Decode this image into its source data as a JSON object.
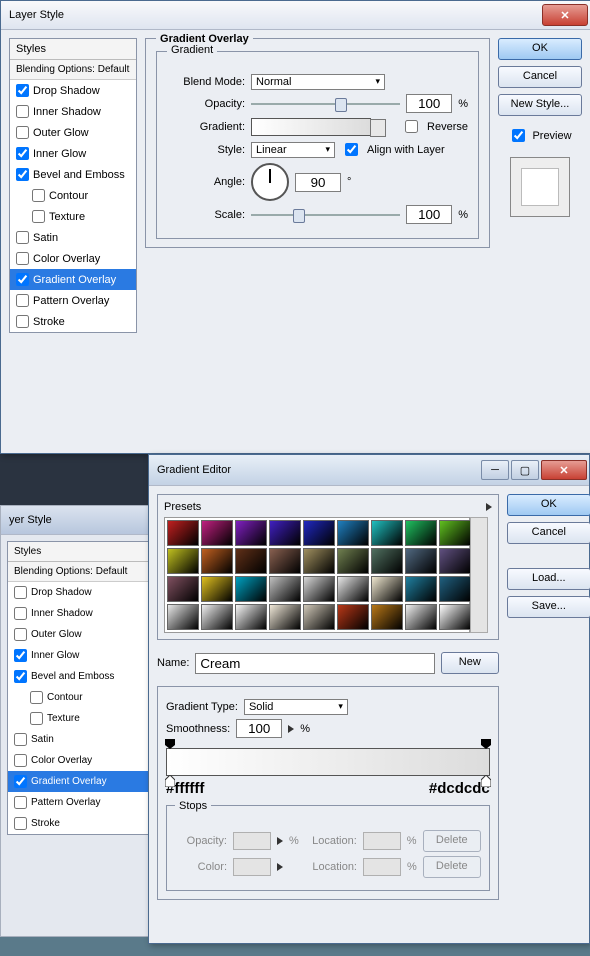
{
  "layerStyle1": {
    "title": "Layer Style",
    "stylesHeader": "Styles",
    "blendingOptions": "Blending Options: Default",
    "items": [
      {
        "label": "Drop Shadow",
        "checked": true,
        "indent": false
      },
      {
        "label": "Inner Shadow",
        "checked": false,
        "indent": false
      },
      {
        "label": "Outer Glow",
        "checked": false,
        "indent": false
      },
      {
        "label": "Inner Glow",
        "checked": true,
        "indent": false
      },
      {
        "label": "Bevel and Emboss",
        "checked": true,
        "indent": false
      },
      {
        "label": "Contour",
        "checked": false,
        "indent": true
      },
      {
        "label": "Texture",
        "checked": false,
        "indent": true
      },
      {
        "label": "Satin",
        "checked": false,
        "indent": false
      },
      {
        "label": "Color Overlay",
        "checked": false,
        "indent": false
      },
      {
        "label": "Gradient Overlay",
        "checked": true,
        "indent": false,
        "selected": true
      },
      {
        "label": "Pattern Overlay",
        "checked": false,
        "indent": false
      },
      {
        "label": "Stroke",
        "checked": false,
        "indent": false
      }
    ],
    "gradientOverlay": {
      "heading": "Gradient Overlay",
      "subheading": "Gradient",
      "blendModeLabel": "Blend Mode:",
      "blendMode": "Normal",
      "opacityLabel": "Opacity:",
      "opacity": "100",
      "opacityUnit": "%",
      "gradientLabel": "Gradient:",
      "reverseLabel": "Reverse",
      "styleLabel": "Style:",
      "style": "Linear",
      "alignLabel": "Align with Layer",
      "angleLabel": "Angle:",
      "angle": "90",
      "angleUnit": "°",
      "scaleLabel": "Scale:",
      "scale": "100",
      "scaleUnit": "%"
    },
    "buttons": {
      "ok": "OK",
      "cancel": "Cancel",
      "newStyle": "New Style...",
      "preview": "Preview"
    }
  },
  "layerStyle2": {
    "title": "yer Style",
    "stylesHeader": "Styles",
    "blendingOptions": "Blending Options: Default",
    "items": [
      {
        "label": "Drop Shadow",
        "checked": false
      },
      {
        "label": "Inner Shadow",
        "checked": false
      },
      {
        "label": "Outer Glow",
        "checked": false
      },
      {
        "label": "Inner Glow",
        "checked": true
      },
      {
        "label": "Bevel and Emboss",
        "checked": true
      },
      {
        "label": "Contour",
        "checked": false,
        "indent": true
      },
      {
        "label": "Texture",
        "checked": false,
        "indent": true
      },
      {
        "label": "Satin",
        "checked": false
      },
      {
        "label": "Color Overlay",
        "checked": false
      },
      {
        "label": "Gradient Overlay",
        "checked": true,
        "selected": true
      },
      {
        "label": "Pattern Overlay",
        "checked": false
      },
      {
        "label": "Stroke",
        "checked": false
      }
    ]
  },
  "gradientEditor": {
    "title": "Gradient Editor",
    "presetsLabel": "Presets",
    "presetColors": [
      "#c02020",
      "#c02080",
      "#8020c0",
      "#4020c0",
      "#2028c0",
      "#2080c0",
      "#20c0c0",
      "#20c060",
      "#60c020",
      "#c0c020",
      "#c06020",
      "#603018",
      "#886050",
      "#a09060",
      "#708050",
      "#507060",
      "#506880",
      "#605080",
      "#805060",
      "#e0c020",
      "#00a0c0",
      "#c0c0c0",
      "#d8d8d8",
      "#e8e8e8",
      "#f0e8d0",
      "#2080a0",
      "#206080",
      "#e8e8e8",
      "#f0f0f0",
      "#f8f8f8",
      "#f0e8d8",
      "#d0c8b8",
      "#b83818",
      "#b87818",
      "#f0f0f0",
      "#ffffff"
    ],
    "nameLabel": "Name:",
    "name": "Cream",
    "newBtn": "New",
    "gradientTypeLabel": "Gradient Type:",
    "gradientType": "Solid",
    "smoothnessLabel": "Smoothness:",
    "smoothness": "100",
    "smoothnessUnit": "%",
    "leftHex": "#ffffff",
    "rightHex": "#dcdcdc",
    "stopsLabel": "Stops",
    "opacityLabel": "Opacity:",
    "pctUnit": "%",
    "locationLabel": "Location:",
    "colorLabel": "Color:",
    "deleteLabel": "Delete",
    "buttons": {
      "ok": "OK",
      "cancel": "Cancel",
      "load": "Load...",
      "save": "Save..."
    }
  }
}
